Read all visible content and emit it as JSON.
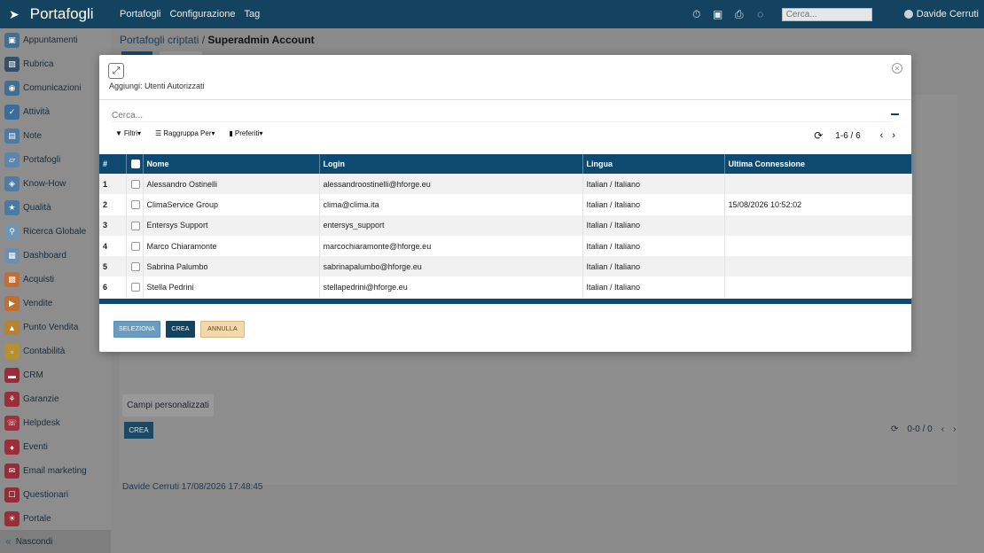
{
  "topbar": {
    "brand": "Portafogli",
    "menu": [
      "Portafogli",
      "Configurazione",
      "Tag"
    ],
    "search_placeholder": "Cerca...",
    "user": "Davide Cerruti",
    "icons": [
      "timer-icon",
      "chat-icon",
      "print-icon",
      "spinner-icon"
    ]
  },
  "sidebar": {
    "items": [
      {
        "label": "Appuntamenti",
        "icon": "calendar-icon",
        "color": "#3e6f94"
      },
      {
        "label": "Rubrica",
        "icon": "contacts-icon",
        "color": "#34506a"
      },
      {
        "label": "Comunicazioni",
        "icon": "chat-icon",
        "color": "#3e6f94"
      },
      {
        "label": "Attività",
        "icon": "check-icon",
        "color": "#3c6c9c"
      },
      {
        "label": "Note",
        "icon": "note-icon",
        "color": "#4a7aa6"
      },
      {
        "label": "Portafogli",
        "icon": "lock-icon",
        "color": "#5e86ad"
      },
      {
        "label": "Know-How",
        "icon": "knowhow-icon",
        "color": "#4d7ca6"
      },
      {
        "label": "Qualità",
        "icon": "quality-icon",
        "color": "#487aa3"
      },
      {
        "label": "Ricerca Globale",
        "icon": "global-search-icon",
        "color": "#6f94b4"
      },
      {
        "label": "Dashboard",
        "icon": "dashboard-icon",
        "color": "#6b8fad"
      },
      {
        "label": "Acquisti",
        "icon": "purchase-icon",
        "color": "#c86b2c"
      },
      {
        "label": "Vendite",
        "icon": "sales-icon",
        "color": "#c0702e"
      },
      {
        "label": "Punto Vendita",
        "icon": "pos-icon",
        "color": "#b8822e"
      },
      {
        "label": "Contabilità",
        "icon": "accounting-icon",
        "color": "#b8902e"
      },
      {
        "label": "CRM",
        "icon": "crm-icon",
        "color": "#9c2b37"
      },
      {
        "label": "Garanzie",
        "icon": "warranty-icon",
        "color": "#9a2f3a"
      },
      {
        "label": "Helpdesk",
        "icon": "helpdesk-icon",
        "color": "#a0303b"
      },
      {
        "label": "Eventi",
        "icon": "events-icon",
        "color": "#a02c38"
      },
      {
        "label": "Email marketing",
        "icon": "email-icon",
        "color": "#9a2a36"
      },
      {
        "label": "Questionari",
        "icon": "survey-icon",
        "color": "#962a35"
      },
      {
        "label": "Portale",
        "icon": "portal-icon",
        "color": "#9a2e38"
      }
    ],
    "hide_label": "Nascondi"
  },
  "background": {
    "breadcrumb_parent": "Portafogli criptati",
    "breadcrumb_sep": "/",
    "breadcrumb_current": "Superadmin Account",
    "custom_fields_button": "Campi personalizzati",
    "create_button": "CREA",
    "pager_range": "0-0 / 0",
    "footer_text": "Davide Cerruti 17/08/2026 17:48:45"
  },
  "modal": {
    "title": "Aggiungi: Utenti Autorizzati",
    "search_placeholder": "Cerca...",
    "filters": [
      "Filtri",
      "Raggruppa Per",
      "Preferiti"
    ],
    "pager_range": "1-6 / 6",
    "columns": [
      "#",
      "",
      "Nome",
      "Login",
      "Lingua",
      "Ultima Connessione"
    ],
    "rows": [
      {
        "n": "1",
        "name": "Alessandro Ostinelli",
        "login": "alessandroostinelli@hforge.eu",
        "lang": "Italian / Italiano",
        "last": ""
      },
      {
        "n": "2",
        "name": "ClimaService Group",
        "login": "clima@clima.ita",
        "lang": "Italian / Italiano",
        "last": "15/08/2026 10:52:02"
      },
      {
        "n": "3",
        "name": "Entersys Support",
        "login": "entersys_support",
        "lang": "Italian / Italiano",
        "last": ""
      },
      {
        "n": "4",
        "name": "Marco Chiaramonte",
        "login": "marcochiaramonte@hforge.eu",
        "lang": "Italian / Italiano",
        "last": ""
      },
      {
        "n": "5",
        "name": "Sabrina Palumbo",
        "login": "sabrinapalumbo@hforge.eu",
        "lang": "Italian / Italiano",
        "last": ""
      },
      {
        "n": "6",
        "name": "Stella Pedrini",
        "login": "stellapedrini@hforge.eu",
        "lang": "Italian / Italiano",
        "last": ""
      }
    ],
    "buttons": {
      "select": "SELEZIONA",
      "create": "CREA",
      "cancel": "ANNULLA"
    }
  },
  "colors": {
    "primary": "#14435f",
    "table_header": "#0e4a6f",
    "cancel": "#f3d8ac"
  }
}
